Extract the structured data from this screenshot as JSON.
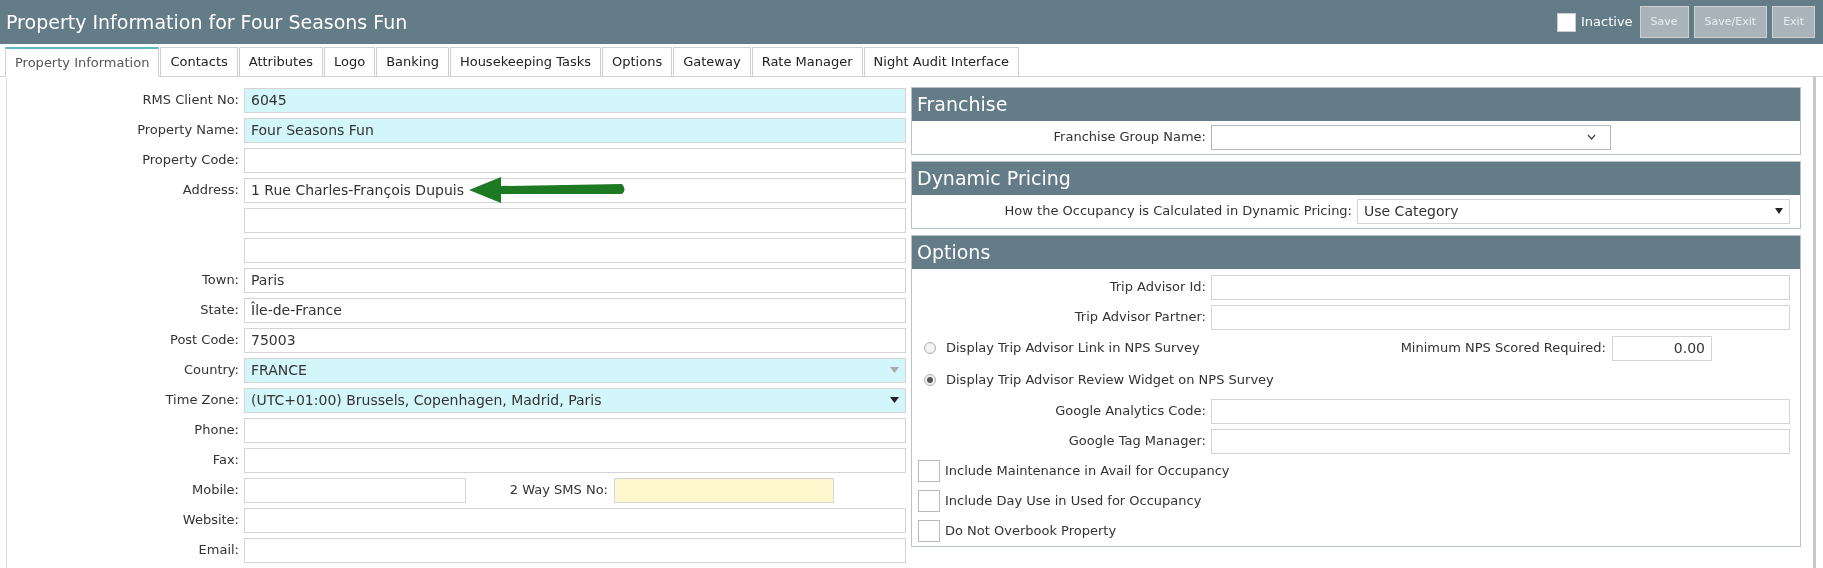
{
  "window": {
    "title": "Property Information for Four Seasons Fun"
  },
  "inactive": {
    "label": "Inactive",
    "checked": false
  },
  "buttons": [
    {
      "label": "Save",
      "disabled": true
    },
    {
      "label": "Save/Exit",
      "disabled": true
    },
    {
      "label": "Exit",
      "disabled": true
    }
  ],
  "tabs": [
    {
      "label": "Property Information",
      "selected": true
    },
    {
      "label": "Contacts",
      "selected": false
    },
    {
      "label": "Attributes",
      "selected": false
    },
    {
      "label": "Logo",
      "selected": false
    },
    {
      "label": "Banking",
      "selected": false
    },
    {
      "label": "Housekeeping Tasks",
      "selected": false
    },
    {
      "label": "Options",
      "selected": false
    },
    {
      "label": "Gateway",
      "selected": false
    },
    {
      "label": "Rate Manager",
      "selected": false
    },
    {
      "label": "Night Audit Interface",
      "selected": false
    }
  ],
  "property_fields": [
    {
      "kind": "text",
      "label": "RMS Client No:",
      "value": "6045",
      "highlighted": true
    },
    {
      "kind": "text",
      "label": "Property Name:",
      "value": "Four Seasons Fun",
      "highlighted": true
    },
    {
      "kind": "text",
      "label": "Property Code:",
      "highlighted": false
    },
    {
      "kind": "text",
      "label": "Address:",
      "value": "1 Rue Charles-François Dupuis",
      "highlighted": false,
      "arrow": true
    },
    {
      "kind": "text",
      "highlighted": false
    },
    {
      "kind": "text",
      "highlighted": false
    },
    {
      "kind": "text",
      "label": "Town:",
      "value": "Paris",
      "highlighted": false
    },
    {
      "kind": "text",
      "label": "State:",
      "value": "Île-de-France",
      "highlighted": false
    },
    {
      "kind": "text",
      "label": "Post Code:",
      "value": "75003",
      "highlighted": false
    },
    {
      "kind": "select",
      "label": "Country:",
      "value": "FRANCE",
      "highlighted": true,
      "disabled": true
    },
    {
      "kind": "select",
      "label": "Time Zone:",
      "value": "(UTC+01:00) Brussels, Copenhagen, Madrid, Paris",
      "highlighted": true,
      "disabled": false
    },
    {
      "kind": "text",
      "label": "Phone:",
      "highlighted": false
    },
    {
      "kind": "text",
      "label": "Fax:",
      "highlighted": false
    },
    {
      "kind": "pair",
      "label": "Mobile:",
      "highlighted": false,
      "second_label": "2 Way SMS No:"
    },
    {
      "kind": "text",
      "label": "Website:",
      "highlighted": false
    },
    {
      "kind": "text",
      "label": "Email:",
      "highlighted": false
    }
  ],
  "sections": [
    {
      "title": "Franchise",
      "items": [
        {
          "kind": "combo",
          "label": "Franchise Group Name:"
        }
      ]
    },
    {
      "title": "Dynamic Pricing",
      "items": [
        {
          "kind": "wideselect",
          "label": "How the Occupancy is Calculated in Dynamic Pricing:",
          "value": "Use Category"
        }
      ]
    },
    {
      "title": "Options",
      "items": [
        {
          "kind": "text",
          "label": "Trip Advisor Id:"
        },
        {
          "kind": "text",
          "label": "Trip Advisor Partner:"
        },
        {
          "kind": "radio",
          "label": "Display Trip Advisor Link in NPS Survey",
          "selected": false,
          "side_label": "Minimum NPS Scored Required:",
          "side_value": "0.00"
        },
        {
          "kind": "radio",
          "label": "Display Trip Advisor Review Widget on NPS Survey",
          "selected": true
        },
        {
          "kind": "text",
          "label": "Google Analytics Code:"
        },
        {
          "kind": "text",
          "label": "Google Tag Manager:"
        },
        {
          "kind": "checkbox",
          "label": "Include Maintenance in Avail for Occupancy",
          "checked": false
        },
        {
          "kind": "checkbox",
          "label": "Include Day Use in Used for Occupancy",
          "checked": false
        },
        {
          "kind": "checkbox",
          "label": "Do Not Overbook Property",
          "checked": false
        }
      ]
    }
  ]
}
